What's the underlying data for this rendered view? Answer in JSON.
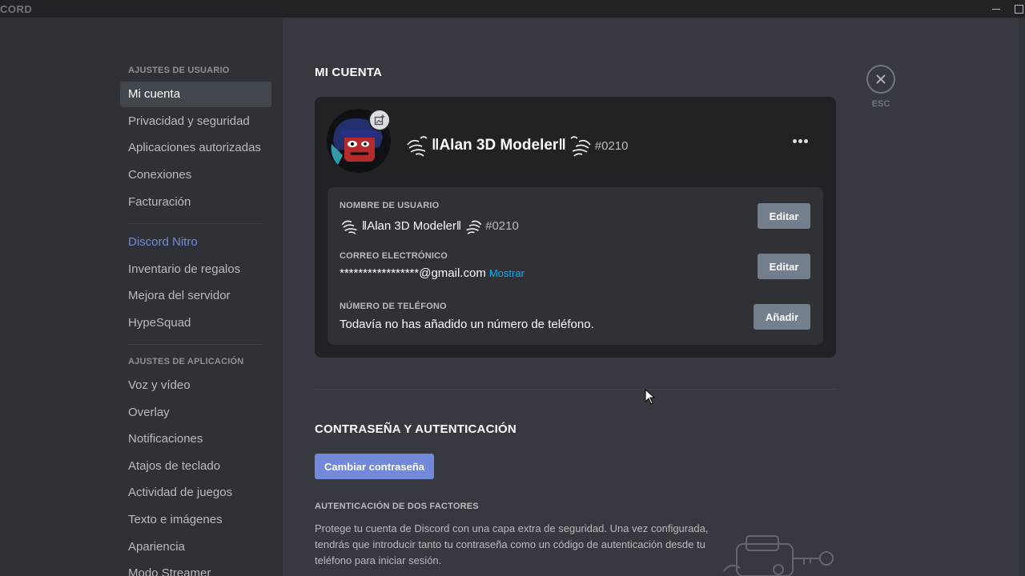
{
  "titlebar": {
    "brand": "CORD"
  },
  "sidebar": {
    "user_settings_header": "AJUSTES DE USUARIO",
    "user_items": [
      {
        "label": "Mi cuenta"
      },
      {
        "label": "Privacidad y seguridad"
      },
      {
        "label": "Aplicaciones autorizadas"
      },
      {
        "label": "Conexiones"
      },
      {
        "label": "Facturación"
      }
    ],
    "nitro_items": [
      {
        "label": "Discord Nitro"
      },
      {
        "label": "Inventario de regalos"
      },
      {
        "label": "Mejora del servidor"
      },
      {
        "label": "HypeSquad"
      }
    ],
    "app_settings_header": "AJUSTES DE APLICACIÓN",
    "app_items": [
      {
        "label": "Voz y vídeo"
      },
      {
        "label": "Overlay"
      },
      {
        "label": "Notificaciones"
      },
      {
        "label": "Atajos de teclado"
      },
      {
        "label": "Actividad de juegos"
      },
      {
        "label": "Texto e imágenes"
      },
      {
        "label": "Apariencia"
      },
      {
        "label": "Modo Streamer"
      }
    ]
  },
  "account": {
    "title": "MI CUENTA",
    "username": "‖Alan 3D Modeler‖",
    "discriminator": "#0210",
    "fields": {
      "username_label": "NOMBRE DE USUARIO",
      "username_value": "‖Alan 3D Modeler‖",
      "username_disc": "#0210",
      "email_label": "CORREO ELECTRÓNICO",
      "email_value": "*****************@gmail.com",
      "email_reveal": "Mostrar",
      "phone_label": "NÚMERO DE TELÉFONO",
      "phone_value": "Todavía no has añadido un número de teléfono.",
      "edit_label": "Editar",
      "add_label": "Añadir"
    }
  },
  "security": {
    "title": "CONTRASEÑA Y AUTENTICACIÓN",
    "change_password": "Cambiar contraseña",
    "tfa_label": "AUTENTICACIÓN DE DOS FACTORES",
    "tfa_description": "Protege tu cuenta de Discord con una capa extra de seguridad. Una vez configurada, tendrás que introducir tanto tu contraseña como un código de autenticación desde tu teléfono para iniciar sesión."
  },
  "close": {
    "label": "ESC"
  },
  "colors": {
    "accent": "#7289da",
    "link": "#00b0f4",
    "background": "#36393f",
    "sidebar": "#2f3136"
  }
}
